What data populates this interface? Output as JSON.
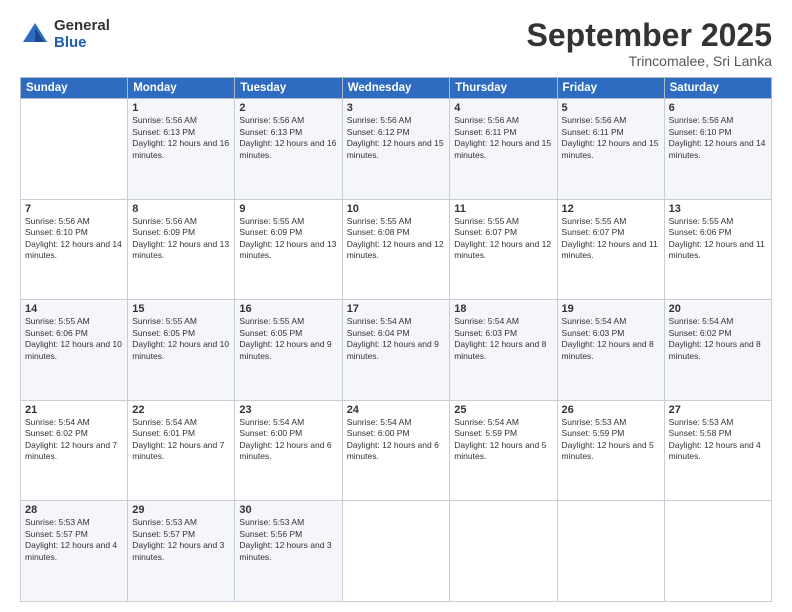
{
  "header": {
    "logo_general": "General",
    "logo_blue": "Blue",
    "month": "September 2025",
    "location": "Trincomalee, Sri Lanka"
  },
  "columns": [
    "Sunday",
    "Monday",
    "Tuesday",
    "Wednesday",
    "Thursday",
    "Friday",
    "Saturday"
  ],
  "weeks": [
    [
      {
        "day": "",
        "sunrise": "",
        "sunset": "",
        "daylight": ""
      },
      {
        "day": "1",
        "sunrise": "Sunrise: 5:56 AM",
        "sunset": "Sunset: 6:13 PM",
        "daylight": "Daylight: 12 hours and 16 minutes."
      },
      {
        "day": "2",
        "sunrise": "Sunrise: 5:56 AM",
        "sunset": "Sunset: 6:13 PM",
        "daylight": "Daylight: 12 hours and 16 minutes."
      },
      {
        "day": "3",
        "sunrise": "Sunrise: 5:56 AM",
        "sunset": "Sunset: 6:12 PM",
        "daylight": "Daylight: 12 hours and 15 minutes."
      },
      {
        "day": "4",
        "sunrise": "Sunrise: 5:56 AM",
        "sunset": "Sunset: 6:11 PM",
        "daylight": "Daylight: 12 hours and 15 minutes."
      },
      {
        "day": "5",
        "sunrise": "Sunrise: 5:56 AM",
        "sunset": "Sunset: 6:11 PM",
        "daylight": "Daylight: 12 hours and 15 minutes."
      },
      {
        "day": "6",
        "sunrise": "Sunrise: 5:56 AM",
        "sunset": "Sunset: 6:10 PM",
        "daylight": "Daylight: 12 hours and 14 minutes."
      }
    ],
    [
      {
        "day": "7",
        "sunrise": "Sunrise: 5:56 AM",
        "sunset": "Sunset: 6:10 PM",
        "daylight": "Daylight: 12 hours and 14 minutes."
      },
      {
        "day": "8",
        "sunrise": "Sunrise: 5:56 AM",
        "sunset": "Sunset: 6:09 PM",
        "daylight": "Daylight: 12 hours and 13 minutes."
      },
      {
        "day": "9",
        "sunrise": "Sunrise: 5:55 AM",
        "sunset": "Sunset: 6:09 PM",
        "daylight": "Daylight: 12 hours and 13 minutes."
      },
      {
        "day": "10",
        "sunrise": "Sunrise: 5:55 AM",
        "sunset": "Sunset: 6:08 PM",
        "daylight": "Daylight: 12 hours and 12 minutes."
      },
      {
        "day": "11",
        "sunrise": "Sunrise: 5:55 AM",
        "sunset": "Sunset: 6:07 PM",
        "daylight": "Daylight: 12 hours and 12 minutes."
      },
      {
        "day": "12",
        "sunrise": "Sunrise: 5:55 AM",
        "sunset": "Sunset: 6:07 PM",
        "daylight": "Daylight: 12 hours and 11 minutes."
      },
      {
        "day": "13",
        "sunrise": "Sunrise: 5:55 AM",
        "sunset": "Sunset: 6:06 PM",
        "daylight": "Daylight: 12 hours and 11 minutes."
      }
    ],
    [
      {
        "day": "14",
        "sunrise": "Sunrise: 5:55 AM",
        "sunset": "Sunset: 6:06 PM",
        "daylight": "Daylight: 12 hours and 10 minutes."
      },
      {
        "day": "15",
        "sunrise": "Sunrise: 5:55 AM",
        "sunset": "Sunset: 6:05 PM",
        "daylight": "Daylight: 12 hours and 10 minutes."
      },
      {
        "day": "16",
        "sunrise": "Sunrise: 5:55 AM",
        "sunset": "Sunset: 6:05 PM",
        "daylight": "Daylight: 12 hours and 9 minutes."
      },
      {
        "day": "17",
        "sunrise": "Sunrise: 5:54 AM",
        "sunset": "Sunset: 6:04 PM",
        "daylight": "Daylight: 12 hours and 9 minutes."
      },
      {
        "day": "18",
        "sunrise": "Sunrise: 5:54 AM",
        "sunset": "Sunset: 6:03 PM",
        "daylight": "Daylight: 12 hours and 8 minutes."
      },
      {
        "day": "19",
        "sunrise": "Sunrise: 5:54 AM",
        "sunset": "Sunset: 6:03 PM",
        "daylight": "Daylight: 12 hours and 8 minutes."
      },
      {
        "day": "20",
        "sunrise": "Sunrise: 5:54 AM",
        "sunset": "Sunset: 6:02 PM",
        "daylight": "Daylight: 12 hours and 8 minutes."
      }
    ],
    [
      {
        "day": "21",
        "sunrise": "Sunrise: 5:54 AM",
        "sunset": "Sunset: 6:02 PM",
        "daylight": "Daylight: 12 hours and 7 minutes."
      },
      {
        "day": "22",
        "sunrise": "Sunrise: 5:54 AM",
        "sunset": "Sunset: 6:01 PM",
        "daylight": "Daylight: 12 hours and 7 minutes."
      },
      {
        "day": "23",
        "sunrise": "Sunrise: 5:54 AM",
        "sunset": "Sunset: 6:00 PM",
        "daylight": "Daylight: 12 hours and 6 minutes."
      },
      {
        "day": "24",
        "sunrise": "Sunrise: 5:54 AM",
        "sunset": "Sunset: 6:00 PM",
        "daylight": "Daylight: 12 hours and 6 minutes."
      },
      {
        "day": "25",
        "sunrise": "Sunrise: 5:54 AM",
        "sunset": "Sunset: 5:59 PM",
        "daylight": "Daylight: 12 hours and 5 minutes."
      },
      {
        "day": "26",
        "sunrise": "Sunrise: 5:53 AM",
        "sunset": "Sunset: 5:59 PM",
        "daylight": "Daylight: 12 hours and 5 minutes."
      },
      {
        "day": "27",
        "sunrise": "Sunrise: 5:53 AM",
        "sunset": "Sunset: 5:58 PM",
        "daylight": "Daylight: 12 hours and 4 minutes."
      }
    ],
    [
      {
        "day": "28",
        "sunrise": "Sunrise: 5:53 AM",
        "sunset": "Sunset: 5:57 PM",
        "daylight": "Daylight: 12 hours and 4 minutes."
      },
      {
        "day": "29",
        "sunrise": "Sunrise: 5:53 AM",
        "sunset": "Sunset: 5:57 PM",
        "daylight": "Daylight: 12 hours and 3 minutes."
      },
      {
        "day": "30",
        "sunrise": "Sunrise: 5:53 AM",
        "sunset": "Sunset: 5:56 PM",
        "daylight": "Daylight: 12 hours and 3 minutes."
      },
      {
        "day": "",
        "sunrise": "",
        "sunset": "",
        "daylight": ""
      },
      {
        "day": "",
        "sunrise": "",
        "sunset": "",
        "daylight": ""
      },
      {
        "day": "",
        "sunrise": "",
        "sunset": "",
        "daylight": ""
      },
      {
        "day": "",
        "sunrise": "",
        "sunset": "",
        "daylight": ""
      }
    ]
  ]
}
